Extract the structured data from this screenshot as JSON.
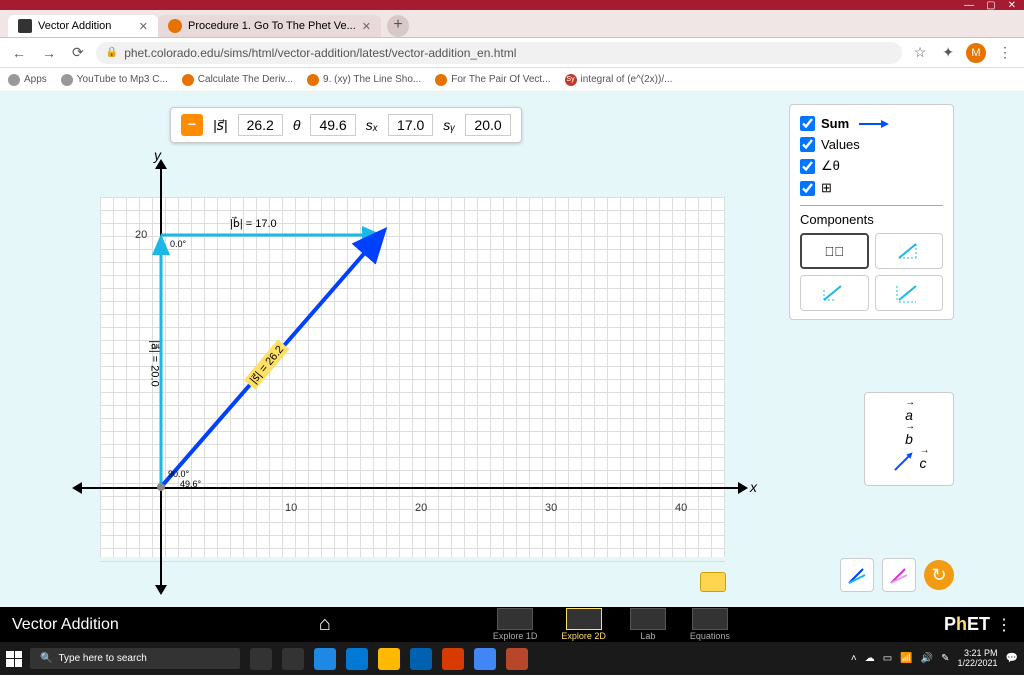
{
  "browser": {
    "tabs": [
      {
        "title": "Vector Addition"
      },
      {
        "title": "Procedure 1. Go To The Phet Ve..."
      }
    ],
    "url": "phet.colorado.edu/sims/html/vector-addition/latest/vector-addition_en.html",
    "bookmarks": [
      "Apps",
      "YouTube to Mp3 C...",
      "Calculate The Deriv...",
      "9. (xy) The Line Sho...",
      "For The Pair Of Vect...",
      "integral of (e^(2x))/..."
    ],
    "profile": "M"
  },
  "readout": {
    "vector_symbol": "|s⃗|",
    "magnitude": "26.2",
    "theta_symbol": "θ",
    "theta": "49.6",
    "sx_symbol": "sₓ",
    "sx": "17.0",
    "sy_symbol": "sᵧ",
    "sy": "20.0"
  },
  "graph": {
    "x_label": "x",
    "y_label": "y",
    "x_ticks": [
      "10",
      "20",
      "30",
      "40"
    ],
    "y_ticks": [
      "20"
    ],
    "vector_a_label": "|a⃗| = 20.0",
    "vector_b_label": "|b⃗| = 17.0",
    "vector_s_label": "|s⃗| = 26.2",
    "angle_a": "90.0°",
    "angle_b": "0.0°",
    "angle_s": "49.6°"
  },
  "right_panel": {
    "sum": "Sum",
    "values": "Values",
    "angle": "∠θ",
    "grid": "⊞",
    "components": "Components"
  },
  "vector_creator": {
    "a": "a",
    "b": "b",
    "c": "c"
  },
  "simnav": {
    "title": "Vector Addition",
    "screens": [
      "Explore 1D",
      "Explore 2D",
      "Lab",
      "Equations"
    ],
    "brand": "PhET"
  },
  "taskbar": {
    "search": "Type here to search",
    "time": "3:21 PM",
    "date": "1/22/2021"
  },
  "chart_data": {
    "type": "vector-diagram",
    "origin": [
      0,
      0
    ],
    "x_range": [
      -5,
      45
    ],
    "y_range": [
      -5,
      25
    ],
    "vectors": [
      {
        "name": "a",
        "from": [
          0,
          0
        ],
        "to": [
          0,
          20
        ],
        "magnitude": 20.0,
        "angle_deg": 90.0,
        "color": "#19b8e6"
      },
      {
        "name": "b",
        "from": [
          0,
          20
        ],
        "to": [
          17,
          20
        ],
        "magnitude": 17.0,
        "angle_deg": 0.0,
        "color": "#19b8e6"
      },
      {
        "name": "s",
        "from": [
          0,
          0
        ],
        "to": [
          17,
          20
        ],
        "magnitude": 26.2,
        "angle_deg": 49.6,
        "color": "#0040ff",
        "is_sum": true
      }
    ]
  }
}
